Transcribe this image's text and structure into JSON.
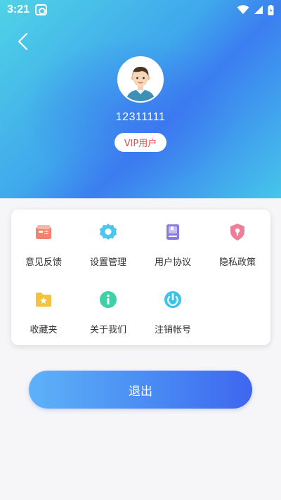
{
  "status_bar": {
    "time": "3:21"
  },
  "profile": {
    "username": "12311111",
    "badge": "VIP用户"
  },
  "menu": {
    "items": [
      {
        "label": "意见反馈",
        "icon": "feedback-icon",
        "color": "#f0836b"
      },
      {
        "label": "设置管理",
        "icon": "gear-icon",
        "color": "#4cc6ee"
      },
      {
        "label": "用户协议",
        "icon": "book-icon",
        "color": "#8b7be0"
      },
      {
        "label": "隐私政策",
        "icon": "shield-lock-icon",
        "color": "#ef7d97"
      },
      {
        "label": "收藏夹",
        "icon": "folder-star-icon",
        "color": "#f5c23c"
      },
      {
        "label": "关于我们",
        "icon": "info-icon",
        "color": "#3ed1a7"
      },
      {
        "label": "注销帐号",
        "icon": "power-icon",
        "color": "#3cc3ea"
      }
    ]
  },
  "logout": {
    "label": "退出"
  },
  "colors": {
    "accent": "#3f66ef",
    "badge_text": "#e94b49"
  }
}
